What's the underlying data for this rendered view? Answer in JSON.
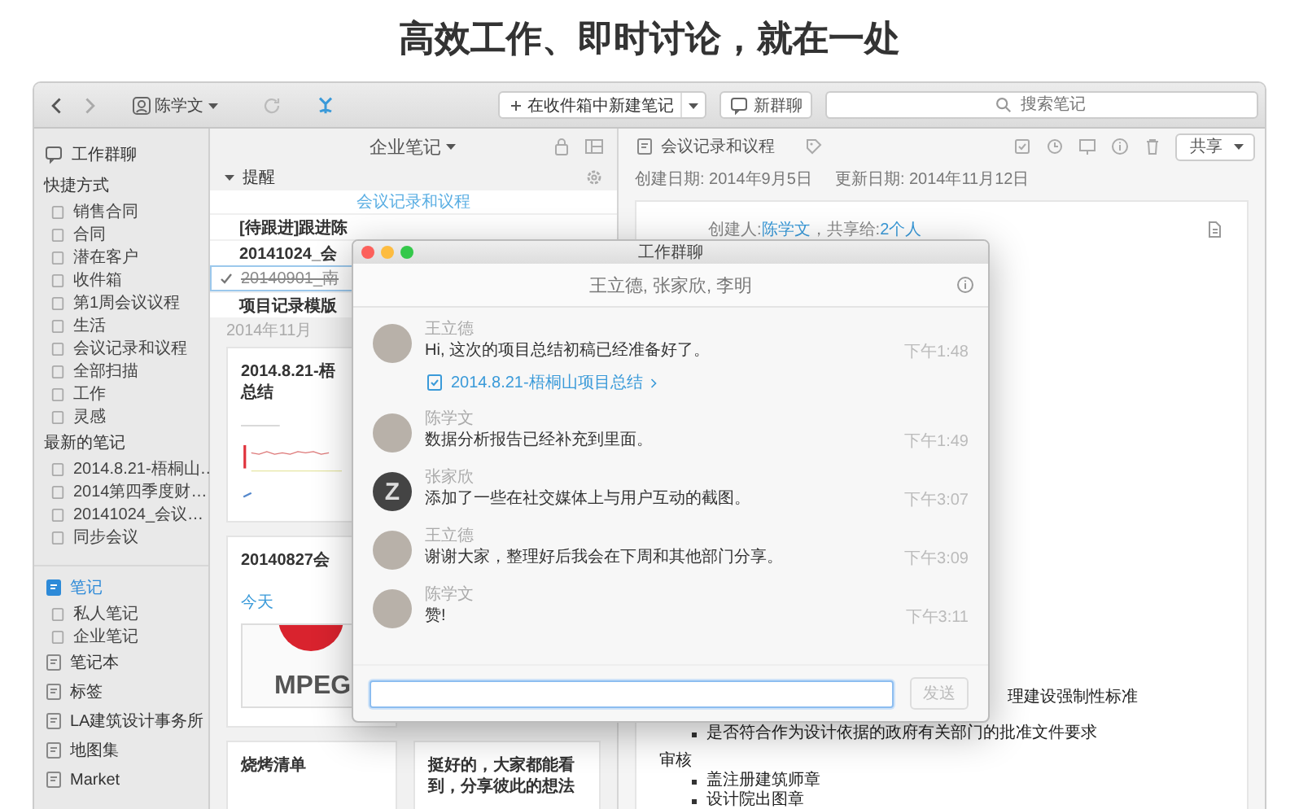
{
  "headline": "高效工作、即时讨论，就在一处",
  "toolbar": {
    "account": "陈学文",
    "new_note": "在收件箱中新建笔记",
    "new_chat": "新群聊",
    "search": {
      "placeholder": "搜索笔记"
    }
  },
  "sidebar": {
    "chat": {
      "label": "工作群聊",
      "selected": false
    },
    "sections": [
      {
        "title": "快捷方式",
        "items": [
          {
            "label": "销售合同",
            "selected": false
          },
          {
            "label": "合同",
            "selected": false
          },
          {
            "label": "潜在客户",
            "selected": false
          },
          {
            "label": "收件箱",
            "selected": false
          },
          {
            "label": "第1周会议议程",
            "selected": false
          },
          {
            "label": "生活",
            "selected": false
          },
          {
            "label": "会议记录和议程",
            "selected": false
          },
          {
            "label": "全部扫描",
            "selected": false
          },
          {
            "label": "工作",
            "selected": false
          },
          {
            "label": "灵感",
            "selected": false
          }
        ]
      },
      {
        "title": "最新的笔记",
        "items": [
          {
            "label": "2014.8.21-梧桐山…",
            "selected": false
          },
          {
            "label": "2014第四季度财…",
            "selected": false
          },
          {
            "label": "20141024_会议…",
            "selected": false
          },
          {
            "label": "同步会议",
            "selected": false
          }
        ]
      }
    ],
    "nav": [
      {
        "label": "笔记",
        "selected": true,
        "children": [
          {
            "label": "私人笔记",
            "selected": false
          },
          {
            "label": "企业笔记",
            "selected": false
          }
        ]
      },
      {
        "label": "笔记本",
        "selected": false
      },
      {
        "label": "标签",
        "selected": false
      },
      {
        "label": "LA建筑设计事务所",
        "selected": false
      },
      {
        "label": "地图集",
        "selected": false
      },
      {
        "label": "Market",
        "selected": false
      }
    ]
  },
  "note_list": {
    "title": "企业笔记",
    "reminders": {
      "title": "提醒",
      "expanded": true,
      "notebook": "会议记录和议程",
      "items": [
        {
          "title": "[待跟进]跟进陈",
          "done": false,
          "selected": false
        },
        {
          "title": "20141024_会",
          "done": false,
          "selected": false
        },
        {
          "title": "20140901_南",
          "done": true,
          "selected": true
        },
        {
          "title": "项目记录模版",
          "done": false,
          "selected": false
        }
      ]
    },
    "month": "2014年11月",
    "columns": [
      [
        {
          "kind": "chart",
          "title_lines": [
            "2014.8.21-梧",
            "总结"
          ]
        },
        {
          "kind": "image",
          "title_lines": [
            "20140827会"
          ],
          "snippet": "今天",
          "image_text": "MPEG"
        },
        {
          "kind": "text",
          "title_lines": [
            "烧烤清单"
          ]
        }
      ],
      [
        {
          "kind": "text",
          "title_lines": [
            "挺好的，大家都能看",
            "到，分享彼此的想法"
          ]
        }
      ]
    ]
  },
  "note": {
    "notebook": "会议记录和议程",
    "share": "共享",
    "created": "创建日期: 2014年9月5日",
    "updated": "更新日期: 2014年11月12日",
    "creator_label": "创建人:",
    "creator": "陈学文",
    "shared_label": "，共享给:",
    "shared": "2个人",
    "lines": [
      {
        "kind": "tail",
        "text": "理建设强制性标准"
      },
      {
        "kind": "bullet",
        "text": "是否符合作为设计依据的政府有关部门的批准文件要求"
      },
      {
        "kind": "heading",
        "text": "审核"
      },
      {
        "kind": "bullet",
        "text": "盖注册建筑师章"
      },
      {
        "kind": "bullet",
        "text": "设计院出图章"
      }
    ]
  },
  "chat": {
    "title": "工作群聊",
    "participants": "王立德, 张家欣, 李明",
    "messages": [
      {
        "sender": "王立德",
        "text": "Hi, 这次的项目总结初稿已经准备好了。",
        "time": "下午1:48",
        "avatar": {
          "kind": "photo"
        },
        "link": "2014.8.21-梧桐山项目总结"
      },
      {
        "sender": "陈学文",
        "text": "数据分析报告已经补充到里面。",
        "time": "下午1:49",
        "avatar": {
          "kind": "photo"
        }
      },
      {
        "sender": "张家欣",
        "text": "添加了一些在社交媒体上与用户互动的截图。",
        "time": "下午3:07",
        "avatar": {
          "kind": "letter",
          "text": "Z"
        }
      },
      {
        "sender": "王立德",
        "text": "谢谢大家，整理好后我会在下周和其他部门分享。",
        "time": "下午3:09",
        "avatar": {
          "kind": "photo"
        }
      },
      {
        "sender": "陈学文",
        "text": "赞!",
        "time": "下午3:11",
        "avatar": {
          "kind": "photo"
        }
      }
    ],
    "input": {
      "focused": true
    },
    "send": {
      "label": "发送",
      "disabled": true
    }
  }
}
